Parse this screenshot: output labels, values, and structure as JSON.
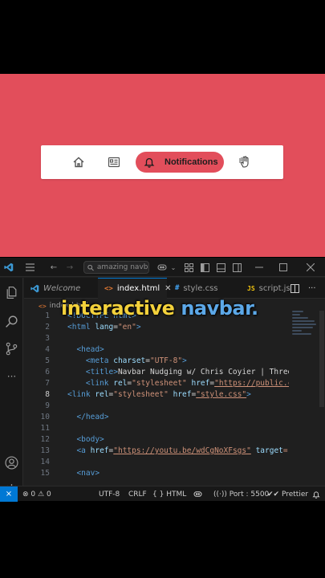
{
  "preview": {
    "navbar": {
      "items": [
        {
          "icon": "home-icon"
        },
        {
          "icon": "card-list-icon"
        },
        {
          "icon": "bell-icon",
          "label": "Notifications",
          "active": true
        },
        {
          "icon": "hand-pointer-icon"
        }
      ]
    },
    "colors": {
      "background": "#e24e5b",
      "navbar": "#ffffff",
      "active_pill": "#e24e5b"
    }
  },
  "editor": {
    "search_placeholder": "amazing navbar",
    "tabs": [
      {
        "label": "Welcome",
        "icon": "vscode-icon"
      },
      {
        "label": "index.html",
        "icon": "html-icon",
        "active": true
      },
      {
        "label": "style.css",
        "icon": "css-hash-icon"
      },
      {
        "label": "script.js",
        "icon": "js-icon"
      }
    ],
    "breadcrumb": "index.html",
    "overlay": {
      "part1": "interactive",
      "part2": "navbar."
    },
    "line_numbers": [
      "1",
      "2",
      "3",
      "4",
      "5",
      "6",
      "7",
      "8",
      "9",
      "10",
      "11",
      "12",
      "13",
      "14",
      "15"
    ],
    "current_line": "8",
    "code": {
      "l1": "<!DOCTYPE html>",
      "l2_tag": "<html",
      "l2_attr": " lang",
      "l2_eq": "=",
      "l2_val": "\"en\"",
      "l2_end": ">",
      "l4": "<head>",
      "l5_tag": "<meta",
      "l5_attr": " charset",
      "l5_val": "\"UTF-8\"",
      "l5_end": ">",
      "l6_open": "<title>",
      "l6_text": "Navbar Nudging w/ Chris Coyier | Three",
      "l7_tag": "<link",
      "l7_attr1": " rel",
      "l7_val1": "\"stylesheet\"",
      "l7_attr2": " href",
      "l7_val2": "\"https://public.c",
      "l8_tag": "<link",
      "l8_attr1": " rel",
      "l8_val1": "\"stylesheet\"",
      "l8_attr2": " href",
      "l8_val2": "\"style.css\"",
      "l8_end": ">",
      "l10": "</head>",
      "l12": "<body>",
      "l13_tag": "<a",
      "l13_attr1": " href",
      "l13_val1": "\"https://youtu.be/wdCgNoXFsgs\"",
      "l13_attr2": " target",
      "l13_val2": "=\"",
      "l15": "<nav>"
    },
    "status": {
      "errors": "0",
      "warnings": "0",
      "encoding": "UTF-8",
      "eol": "CRLF",
      "language": "HTML",
      "port": "Port : 5500",
      "formatter": "Prettier"
    }
  }
}
